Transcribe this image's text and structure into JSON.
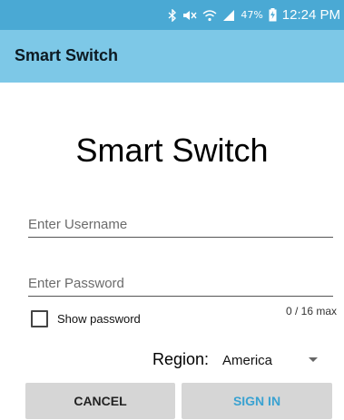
{
  "status_bar": {
    "icons": [
      "bluetooth-icon",
      "mute-icon",
      "wifi-icon",
      "signal-icon",
      "battery-charging-icon"
    ],
    "battery": "47%",
    "time": "12:24 PM"
  },
  "app_bar": {
    "title": "Smart Switch"
  },
  "main": {
    "title": "Smart Switch",
    "username": {
      "placeholder": "Enter Username",
      "value": ""
    },
    "password": {
      "placeholder": "Enter Password",
      "value": ""
    },
    "password_counter": "0 / 16 max",
    "show_password": {
      "label": "Show password",
      "checked": false
    },
    "region": {
      "label": "Region:",
      "value": "America"
    }
  },
  "buttons": {
    "cancel": "CANCEL",
    "sign_in": "SIGN IN"
  },
  "colors": {
    "status_bar": "#4aa9d4",
    "app_bar": "#7dc8e7",
    "accent": "#3aa2d1",
    "button_bg": "#d6d6d6"
  }
}
